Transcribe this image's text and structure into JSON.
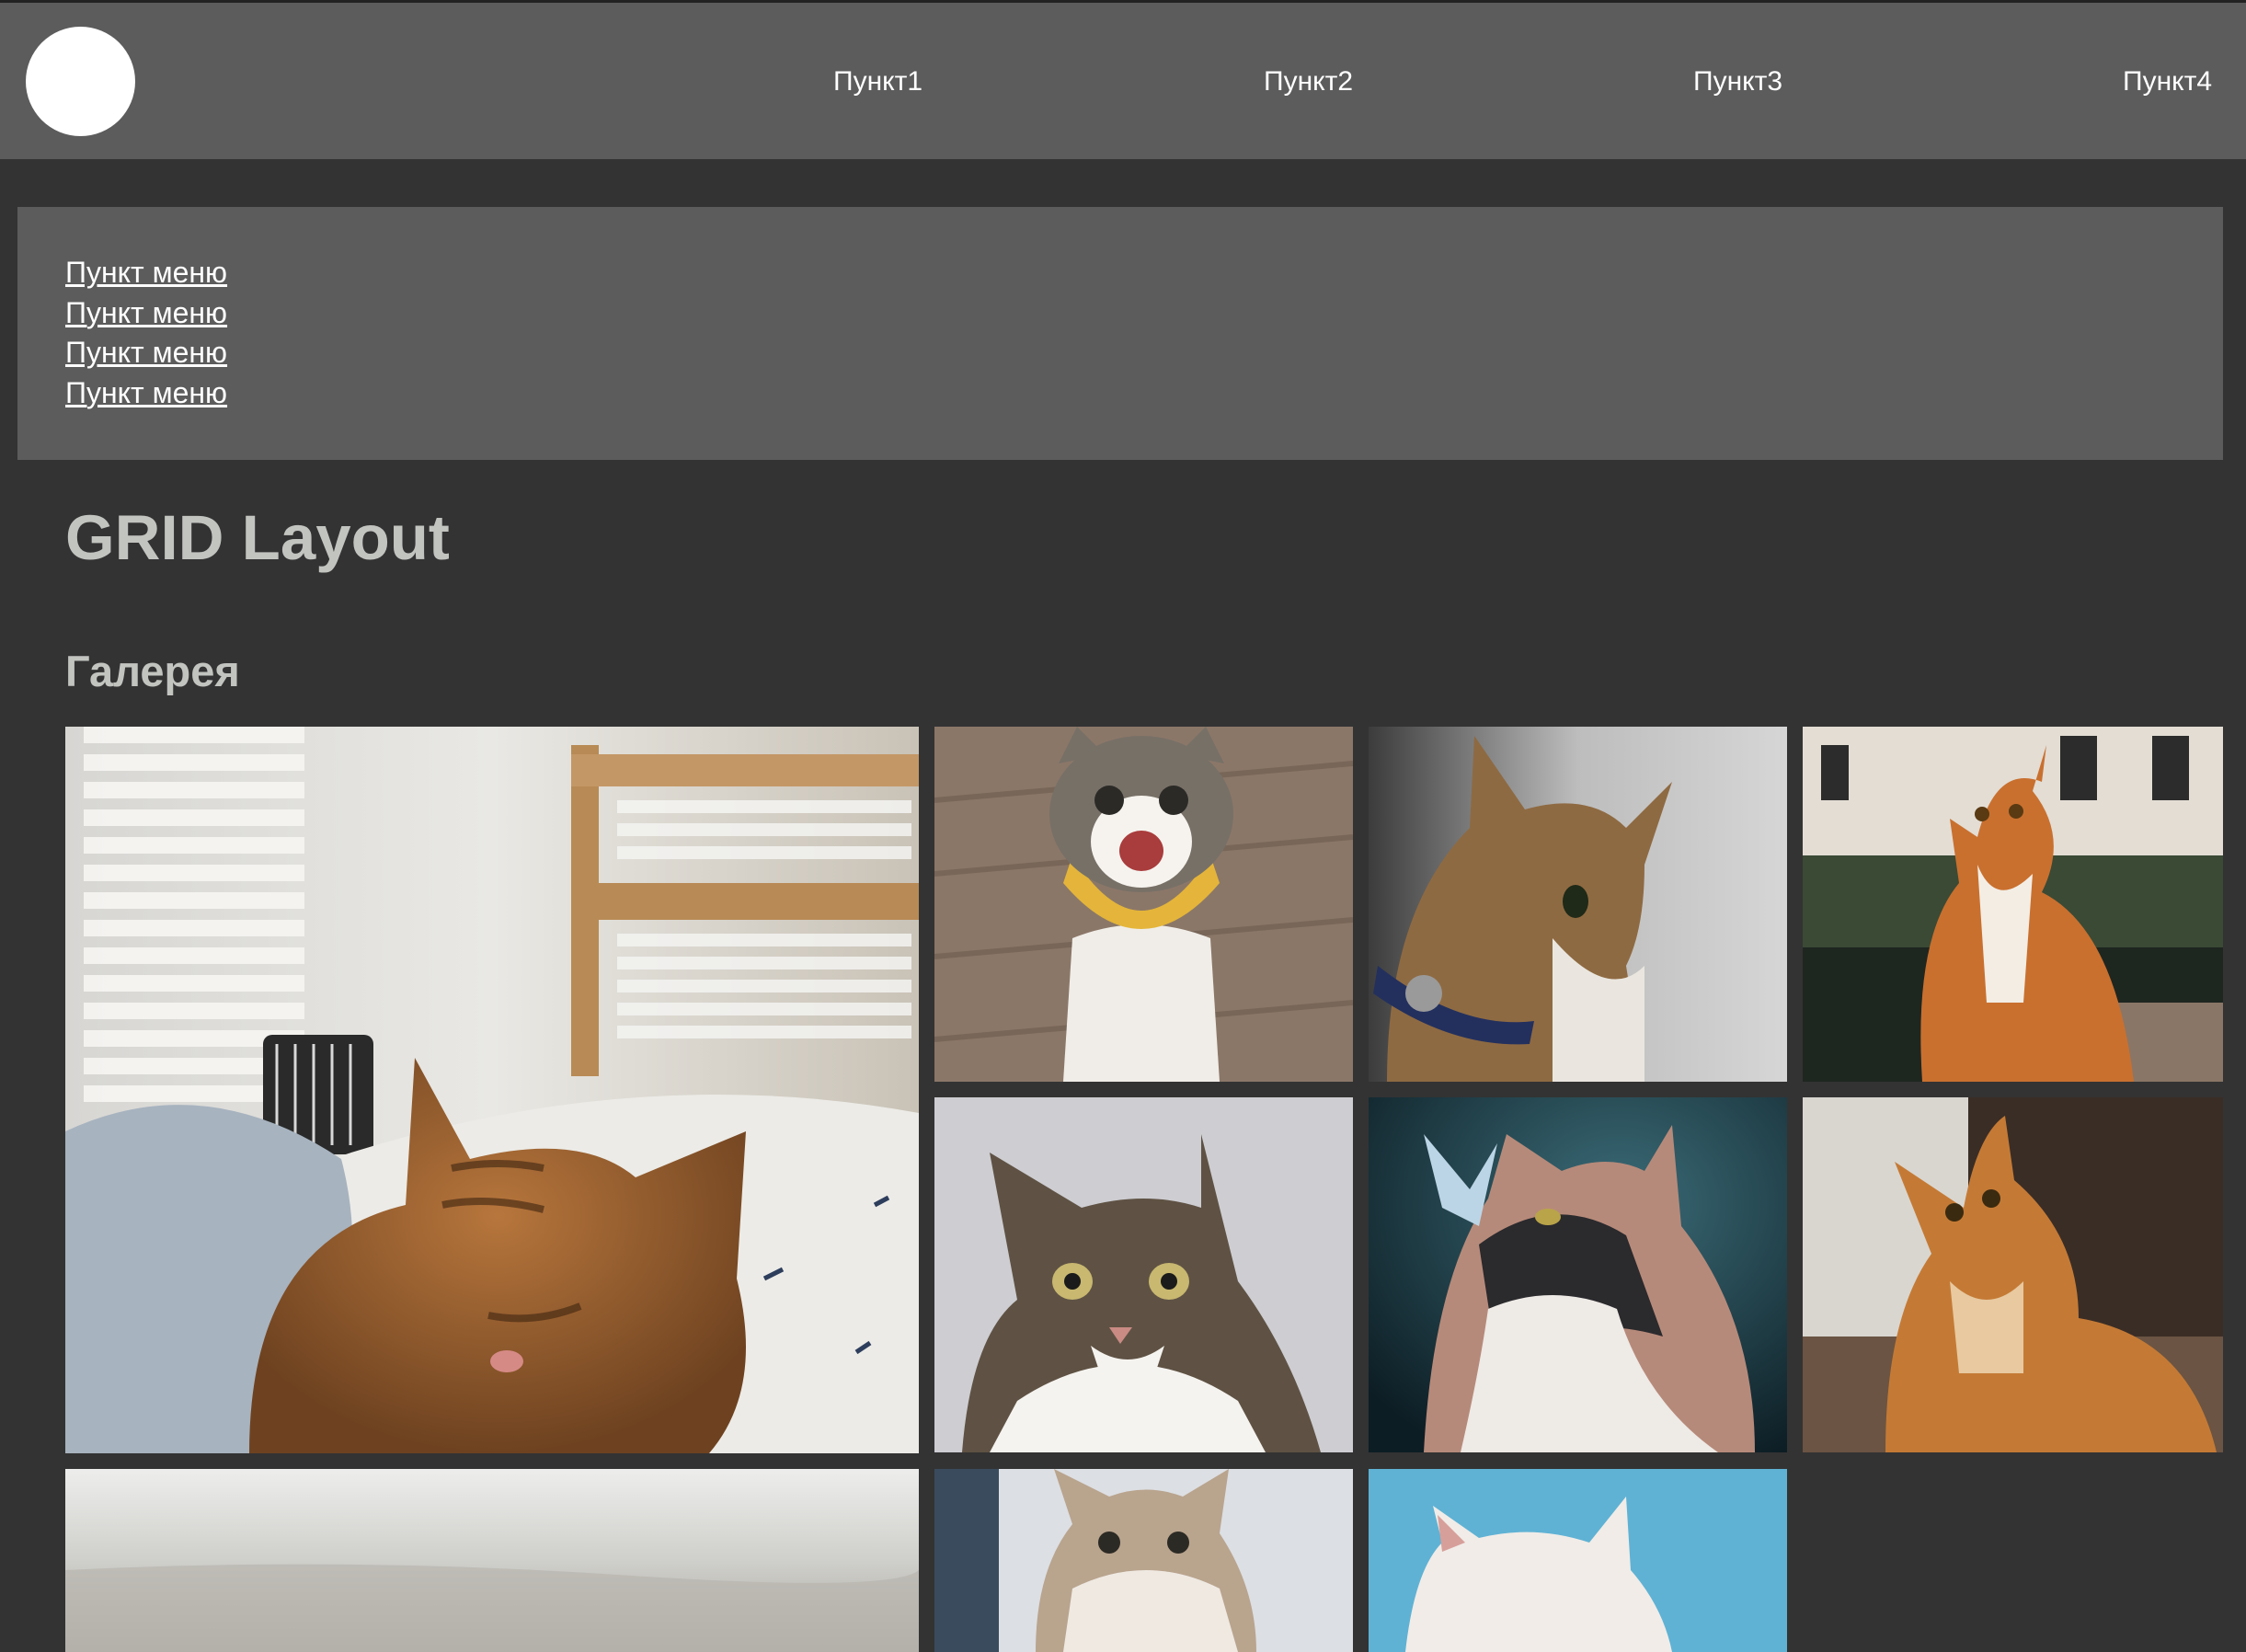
{
  "header": {
    "nav": [
      {
        "label": "Пункт1"
      },
      {
        "label": "Пункт2"
      },
      {
        "label": "Пункт3"
      },
      {
        "label": "Пункт4"
      }
    ]
  },
  "menu": {
    "items": [
      {
        "label": "Пункт меню"
      },
      {
        "label": "Пункт меню"
      },
      {
        "label": "Пункт меню"
      },
      {
        "label": "Пункт меню"
      }
    ]
  },
  "main": {
    "title": "GRID Layout",
    "gallery_title": "Галерея",
    "gallery": [
      {
        "subject": "sleeping tabby cat on bed"
      },
      {
        "subject": "meowing cat with yellow bandana"
      },
      {
        "subject": "tabby cat profile with blue collar"
      },
      {
        "subject": "ginger cat sitting on embankment"
      },
      {
        "subject": "tabby and white cat portrait"
      },
      {
        "subject": "fluffy cat with butterfly"
      },
      {
        "subject": "ginger cat looking up"
      },
      {
        "subject": "blurred field"
      },
      {
        "subject": "fluffy kitten"
      },
      {
        "subject": "white cat on blue background"
      }
    ]
  },
  "colors": {
    "background": "#333333",
    "panel": "#5c5c5c",
    "heading": "#c2c4c0",
    "text": "#ffffff"
  }
}
